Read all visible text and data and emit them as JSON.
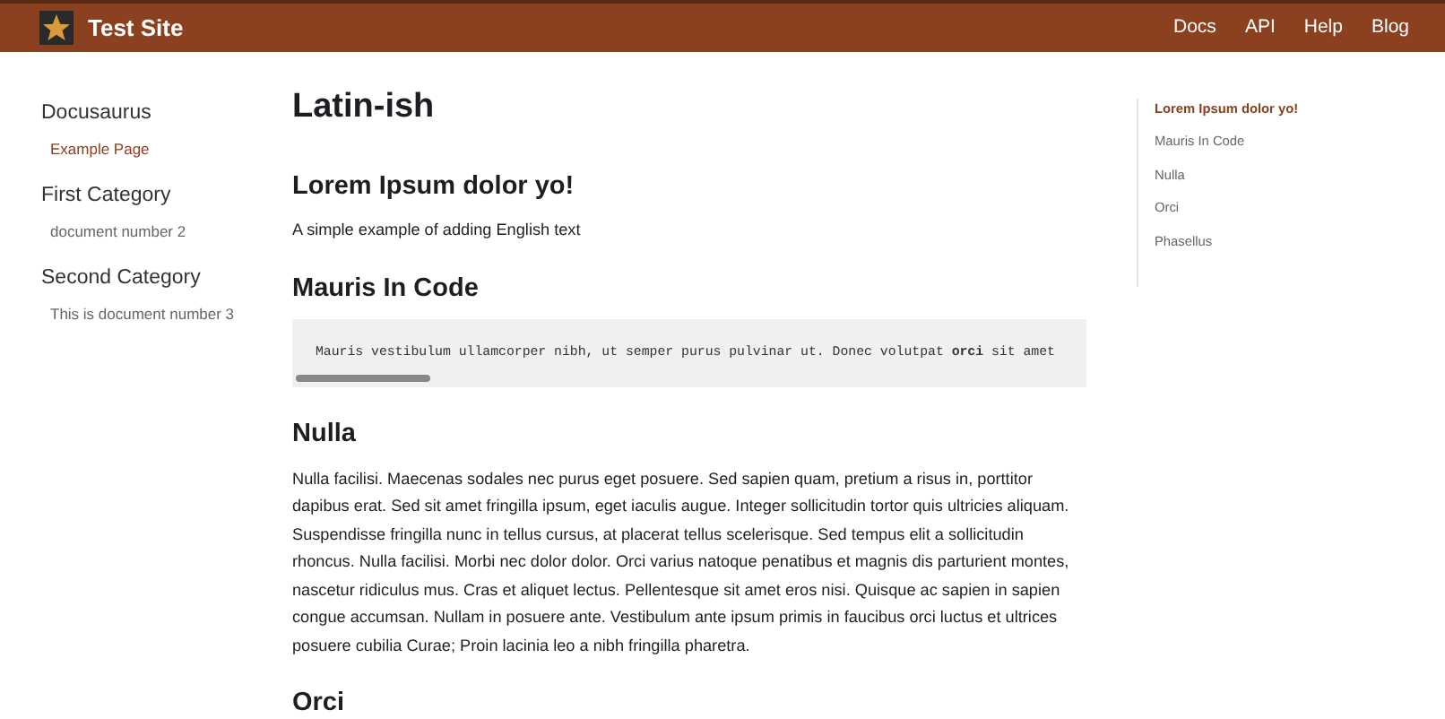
{
  "navbar": {
    "title": "Test Site",
    "links": [
      "Docs",
      "API",
      "Help",
      "Blog"
    ]
  },
  "sidebar": {
    "groups": [
      {
        "title": "Docusaurus",
        "items": [
          {
            "label": "Example Page",
            "selected": true
          }
        ]
      },
      {
        "title": "First Category",
        "items": [
          {
            "label": "document number 2",
            "selected": false
          }
        ]
      },
      {
        "title": "Second Category",
        "items": [
          {
            "label": "This is document number 3",
            "selected": false
          }
        ]
      }
    ]
  },
  "article": {
    "title": "Latin-ish",
    "sections": [
      {
        "kind": "text",
        "heading": "Lorem Ipsum dolor yo!",
        "body": "A simple example of adding English text"
      },
      {
        "kind": "code",
        "heading": "Mauris In Code",
        "body": "Mauris vestibulum ullamcorper nibh, ut semper purus pulvinar ut. Donec volutpat **orci** sit amet"
      },
      {
        "kind": "text",
        "heading": "Nulla",
        "body": "Nulla facilisi. Maecenas sodales nec purus eget posuere. Sed sapien quam, pretium a risus in, porttitor dapibus erat. Sed sit amet fringilla ipsum, eget iaculis augue. Integer sollicitudin tortor quis ultricies aliquam. Suspendisse fringilla nunc in tellus cursus, at placerat tellus scelerisque. Sed tempus elit a sollicitudin rhoncus. Nulla facilisi. Morbi nec dolor dolor. Orci varius natoque penatibus et magnis dis parturient montes, nascetur ridiculus mus. Cras et aliquet lectus. Pellentesque sit amet eros nisi. Quisque ac sapien in sapien congue accumsan. Nullam in posuere ante. Vestibulum ante ipsum primis in faucibus orci luctus et ultrices posuere cubilia Curae; Proin lacinia leo a nibh fringilla pharetra."
      },
      {
        "kind": "heading",
        "heading": "Orci"
      }
    ]
  },
  "toc": [
    {
      "label": "Lorem Ipsum dolor yo!",
      "selected": true
    },
    {
      "label": "Mauris In Code",
      "selected": false
    },
    {
      "label": "Nulla",
      "selected": false
    },
    {
      "label": "Orci",
      "selected": false
    },
    {
      "label": "Phasellus",
      "selected": false
    }
  ]
}
